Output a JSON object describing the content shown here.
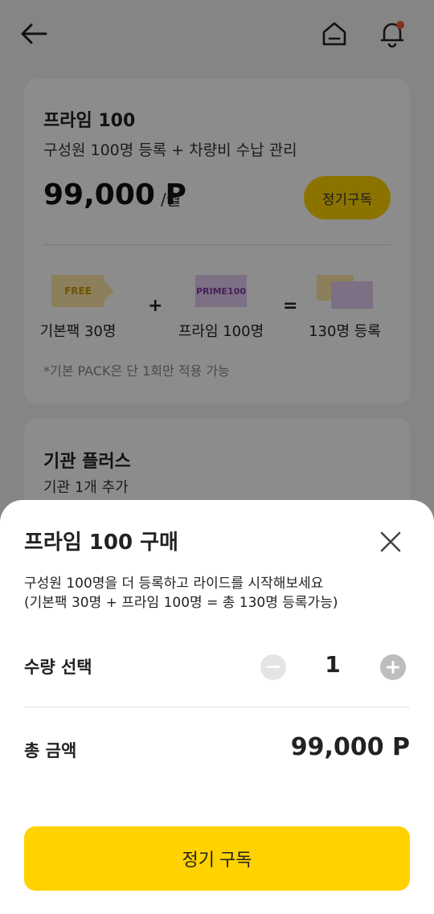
{
  "header": {
    "back_icon": "arrow-left-icon",
    "home_icon": "home-icon",
    "bell_icon": "bell-icon",
    "notification_color": "#f05a3a"
  },
  "plan_card": {
    "title": "프라임 100",
    "description": "구성원 100명 등록 + 차량비 수납 관리",
    "price": "99,000 P",
    "price_unit": "/월",
    "subscribe_label": "정기구독",
    "packs": [
      {
        "tag": "FREE",
        "label": "기본팩 30명"
      },
      {
        "tag": "PRIME100",
        "label": "프라임 100명"
      },
      {
        "tag": "",
        "label": "130명 등록"
      }
    ],
    "plus": "+",
    "equals": "=",
    "note": "*기본 PACK은 단 1회만 적용 가능"
  },
  "org_card": {
    "title": "기관 플러스",
    "description": "기관 1개 추가"
  },
  "sheet": {
    "title": "프라임 100 구매",
    "close_icon": "close-icon",
    "description_line1": "구성원 100명을 더 등록하고 라이드를 시작해보세요",
    "description_line2": "(기본팩 30명 + 프라임 100명 = 총 130명 등록가능)",
    "quantity_label": "수량 선택",
    "quantity": "1",
    "total_label": "총 금액",
    "total_value": "99,000 P",
    "cta_label": "정기 구독"
  },
  "colors": {
    "accent": "#ffd200",
    "free_tag": "#ffeaa8",
    "prime_tag": "#e3cdf1"
  }
}
